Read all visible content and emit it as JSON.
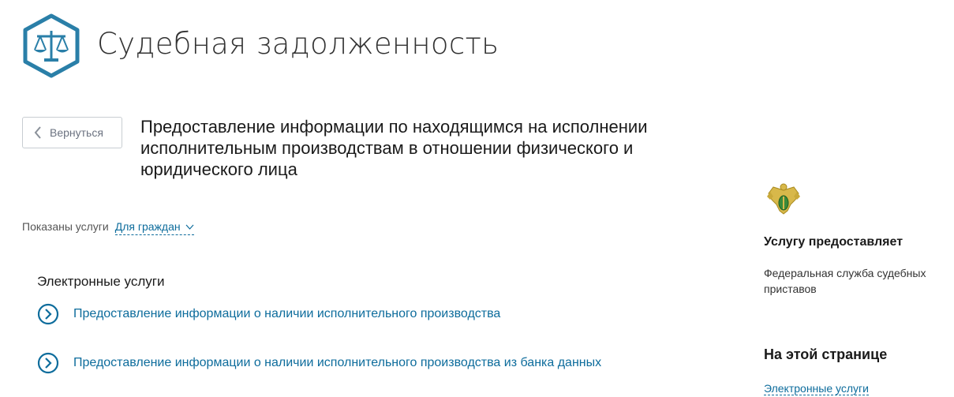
{
  "header": {
    "title": "Судебная задолженность",
    "logo_icon": "scales-of-justice-icon"
  },
  "back_button": {
    "label": "Вернуться",
    "icon": "chevron-left-icon"
  },
  "service": {
    "title": "Предоставление информации по находящимся на исполнении исполнительным производствам в отношении физического и юридического лица"
  },
  "filter": {
    "label": "Показаны услуги",
    "selected": "Для граждан",
    "icon": "chevron-down-icon"
  },
  "electronic": {
    "heading": "Электронные услуги",
    "items": [
      {
        "label": "Предоставление информации о наличии исполнительного производства",
        "icon": "circle-chevron-right-icon"
      },
      {
        "label": "Предоставление информации о наличии исполнительного производства из банка данных",
        "icon": "circle-chevron-right-icon"
      }
    ]
  },
  "sidebar": {
    "provider_heading": "Услугу предоставляет",
    "provider_name": "Федеральная служба судебных приставов",
    "emblem_icon": "fssp-emblem-icon",
    "on_page_heading": "На этой странице",
    "on_page_links": [
      "Электронные услуги"
    ]
  },
  "colors": {
    "accent": "#0d6c9c",
    "logo": "#2a7fa8"
  }
}
